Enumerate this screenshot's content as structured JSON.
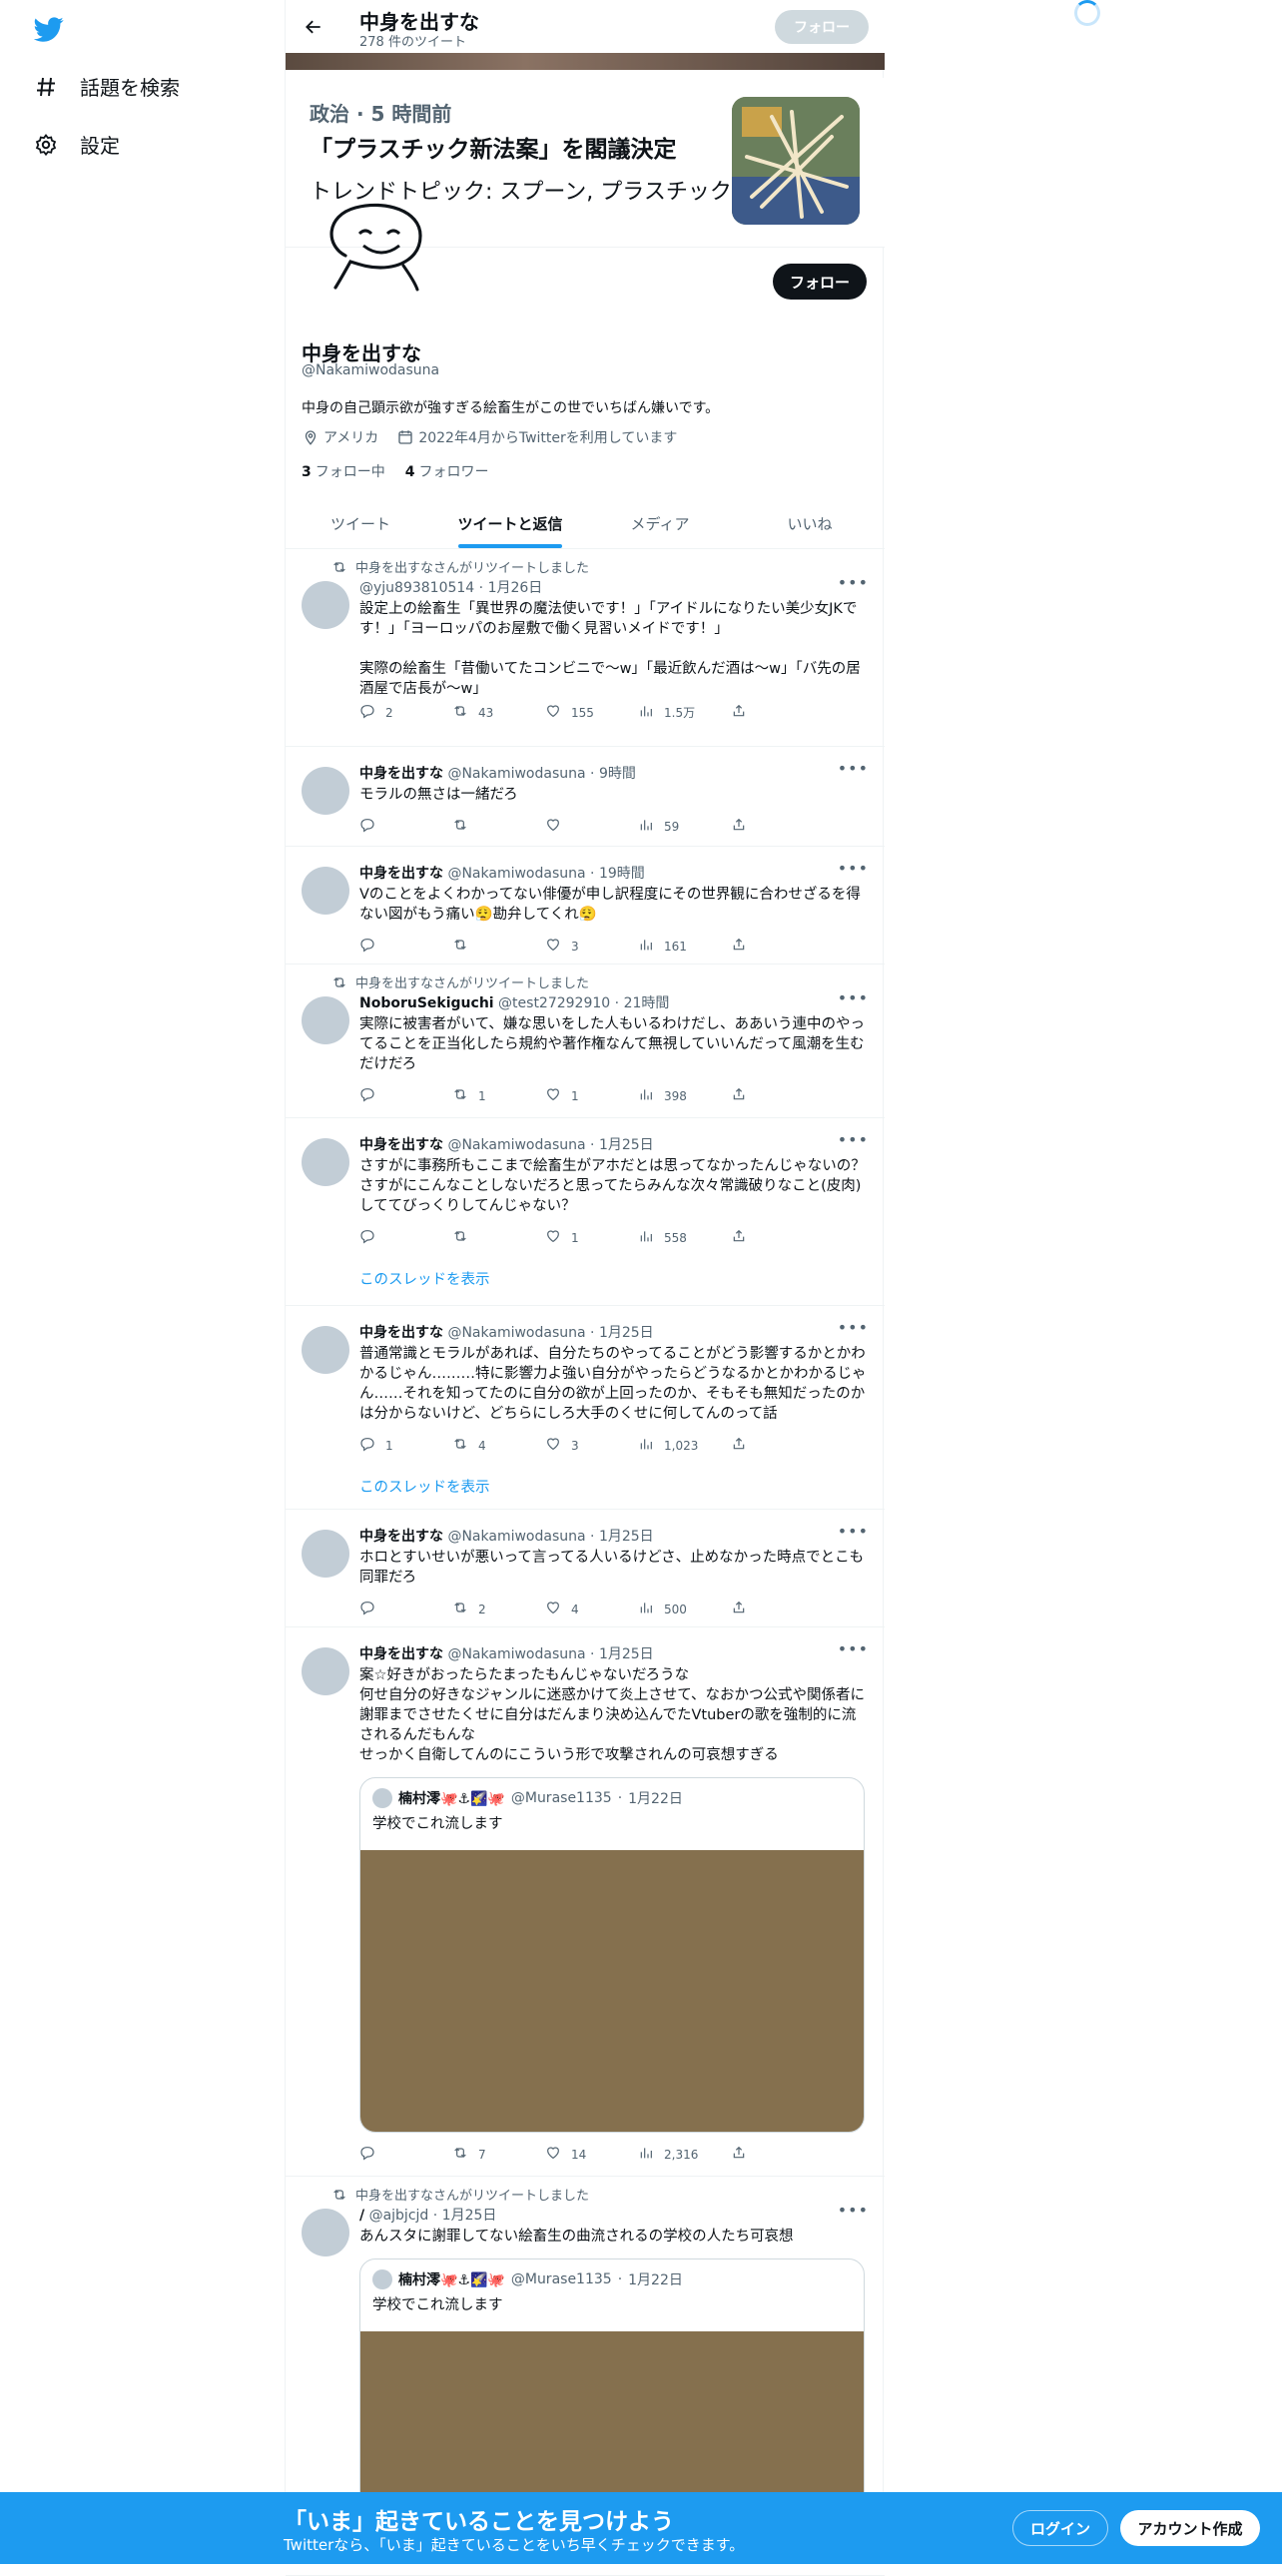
{
  "nav": {
    "explore": "話題を検索",
    "settings": "設定"
  },
  "header": {
    "name": "中身を出すな",
    "count": "278 件のツイート",
    "follow": "フォロー"
  },
  "trend": {
    "meta": "政治 · 5 時間前",
    "title": "「プラスチック新法案」を閣議決定",
    "sub": "トレンドトピック: スプーン, プラスチック"
  },
  "profile": {
    "follow": "フォロー",
    "name": "中身を出すな",
    "handle": "@Nakamiwodasuna",
    "bio": "中身の自己顕示欲が強すぎる絵畜生がこの世でいちばん嫌いです。",
    "location": "アメリカ",
    "joined": "2022年4月からTwitterを利用しています",
    "following_count": "3",
    "following_label": "フォロー中",
    "followers_count": "4",
    "followers_label": "フォロワー"
  },
  "tabs": [
    "ツイート",
    "ツイートと返信",
    "メディア",
    "いいね"
  ],
  "thread_label": "このスレッドを表示",
  "tweets": [
    {
      "rt": "中身を出すなさんがリツイートしました",
      "name": "",
      "handle": "@yju893810514",
      "time": "1月26日",
      "text": "設定上の絵畜生「異世界の魔法使いです！」「アイドルになりたい美少女JKです！」「ヨーロッパのお屋敷で働く見習いメイドです！」\n\n実際の絵畜生「昔働いてたコンビニで～w」「最近飲んだ酒は～w」「バ先の居酒屋で店長が～w」",
      "reply": "2",
      "retweet": "43",
      "like": "155",
      "views": "1.5万"
    },
    {
      "rt": "",
      "name": "中身を出すな",
      "handle": "@Nakamiwodasuna",
      "time": "9時間",
      "text": "モラルの無さは一緒だろ",
      "reply": "",
      "retweet": "",
      "like": "",
      "views": "59"
    },
    {
      "rt": "",
      "name": "中身を出すな",
      "handle": "@Nakamiwodasuna",
      "time": "19時間",
      "text": "Vのことをよくわかってない俳優が申し訳程度にその世界観に合わせざるを得ない図がもう痛い😮‍💨勘弁してくれ😮‍💨",
      "reply": "",
      "retweet": "",
      "like": "3",
      "views": "161"
    },
    {
      "rt": "中身を出すなさんがリツイートしました",
      "name": "NoboruSekiguchi",
      "handle": "@test27292910",
      "time": "21時間",
      "text": "実際に被害者がいて、嫌な思いをした人もいるわけだし、ああいう連中のやってることを正当化したら規約や著作権なんて無視していいんだって風潮を生むだけだろ",
      "reply": "",
      "retweet": "1",
      "like": "1",
      "views": "398"
    },
    {
      "rt": "",
      "name": "中身を出すな",
      "handle": "@Nakamiwodasuna",
      "time": "1月25日",
      "text": "さすがに事務所もここまで絵畜生がアホだとは思ってなかったんじゃないの？さすがにこんなことしないだろと思ってたらみんな次々常識破りなこと(皮肉)しててびっくりしてんじゃない？",
      "reply": "",
      "retweet": "",
      "like": "1",
      "views": "558"
    },
    {
      "rt": "",
      "name": "中身を出すな",
      "handle": "@Nakamiwodasuna",
      "time": "1月25日",
      "text": "普通常識とモラルがあれば、自分たちのやってることがどう影響するかとかわかるじゃん………特に影響力よ強い自分がやったらどうなるかとかわかるじゃん……それを知ってたのに自分の欲が上回ったのか、そもそも無知だったのかは分からないけど、どちらにしろ大手のくせに何してんのって話",
      "reply": "1",
      "retweet": "4",
      "like": "3",
      "views": "1,023"
    },
    {
      "rt": "",
      "name": "中身を出すな",
      "handle": "@Nakamiwodasuna",
      "time": "1月25日",
      "text": "ホロとすいせいが悪いって言ってる人いるけどさ、止めなかった時点でとこも同罪だろ",
      "reply": "",
      "retweet": "2",
      "like": "4",
      "views": "500"
    },
    {
      "rt": "",
      "name": "中身を出すな",
      "handle": "@Nakamiwodasuna",
      "time": "1月25日",
      "text": "案☆好きがおったらたまったもんじゃないだろうな\n何せ自分の好きなジャンルに迷惑かけて炎上させて、なおかつ公式や関係者に謝罪までさせたくせに自分はだんまり決め込んでたVtuberの歌を強制的に流されるんだもんな\nせっかく自衛してんのにこういう形で攻撃されんの可哀想すぎる",
      "reply": "",
      "retweet": "7",
      "like": "14",
      "views": "2,316",
      "quote": {
        "name": "楠村澪🐙⚓🌠🐙",
        "handle": "@Murase1135",
        "time": "1月22日",
        "text": "学校でこれ流します"
      }
    },
    {
      "rt": "中身を出すなさんがリツイートしました",
      "name": "/",
      "handle": "@ajbjcjd",
      "time": "1月25日",
      "text": "あんスタに謝罪してない絵畜生の曲流されるの学校の人たち可哀想",
      "quote": {
        "name": "楠村澪🐙⚓🌠🐙",
        "handle": "@Murase1135",
        "time": "1月22日",
        "text": "学校でこれ流します"
      }
    }
  ],
  "bottom": {
    "title": "「いま」起きていることを見つけよう",
    "sub": "Twitterなら、「いま」起きていることをいち早くチェックできます。",
    "login": "ログイン",
    "signup": "アカウント作成"
  },
  "colors": {
    "accent": "#1d9bf0",
    "text": "#0f1419",
    "muted": "#536471"
  }
}
